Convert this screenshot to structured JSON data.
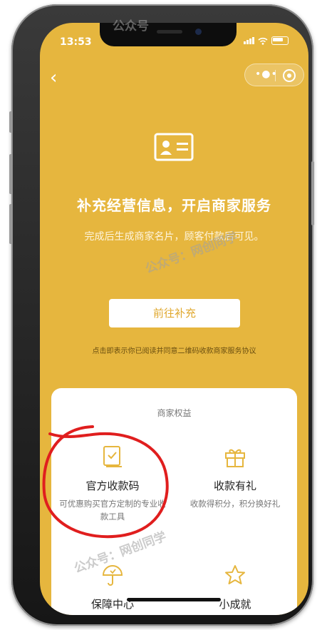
{
  "status_bar": {
    "time": "13:53"
  },
  "nav": {
    "back_glyph": "‹",
    "menu_glyph": "•●•"
  },
  "hero": {
    "headline": "补充经营信息，开启商家服务",
    "subline": "完成后生成商家名片，顾客付款后可见。",
    "cta_label": "前往补充",
    "agreement": "点击即表示你已阅读并同意二维码收款商家服务协议"
  },
  "benefits": {
    "title": "商家权益",
    "items": [
      {
        "name": "官方收款码",
        "desc": "可优惠购买官方定制的专业收款工具",
        "icon": "receipt-code-icon"
      },
      {
        "name": "收款有礼",
        "desc": "收款得积分，积分换好礼",
        "icon": "gift-icon"
      },
      {
        "name": "保障中心",
        "desc": "",
        "icon": "umbrella-icon"
      },
      {
        "name": "小成就",
        "desc": "",
        "icon": "star-icon"
      }
    ]
  },
  "watermark": {
    "text_top": "公众号",
    "text_mid": "公众号：网创同学",
    "text_bottom": "公众号：网创同学"
  },
  "colors": {
    "brand": "#e6b63e",
    "annotation": "#e01e1e"
  }
}
